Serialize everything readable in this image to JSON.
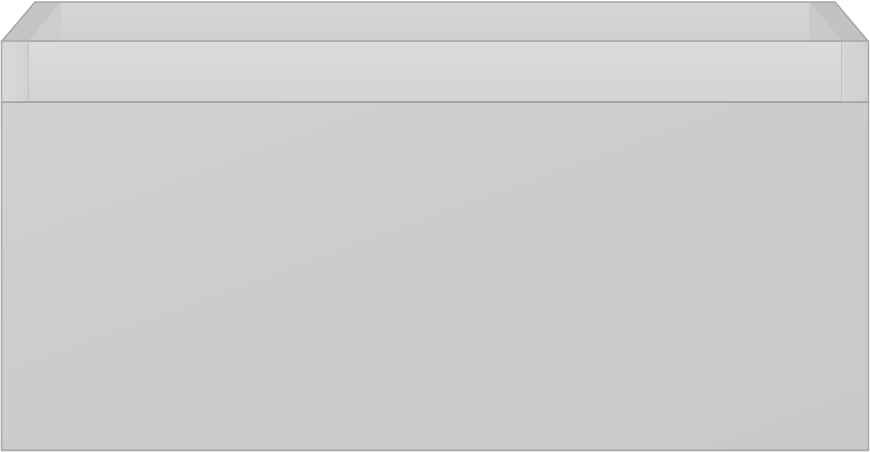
{
  "scene": {
    "subject": "storage-box-render",
    "colors": {
      "panel": "#cccccc",
      "rim": "#d6d6d6",
      "interior": "#d3d3d3",
      "edge": "#a6a6a6"
    }
  }
}
